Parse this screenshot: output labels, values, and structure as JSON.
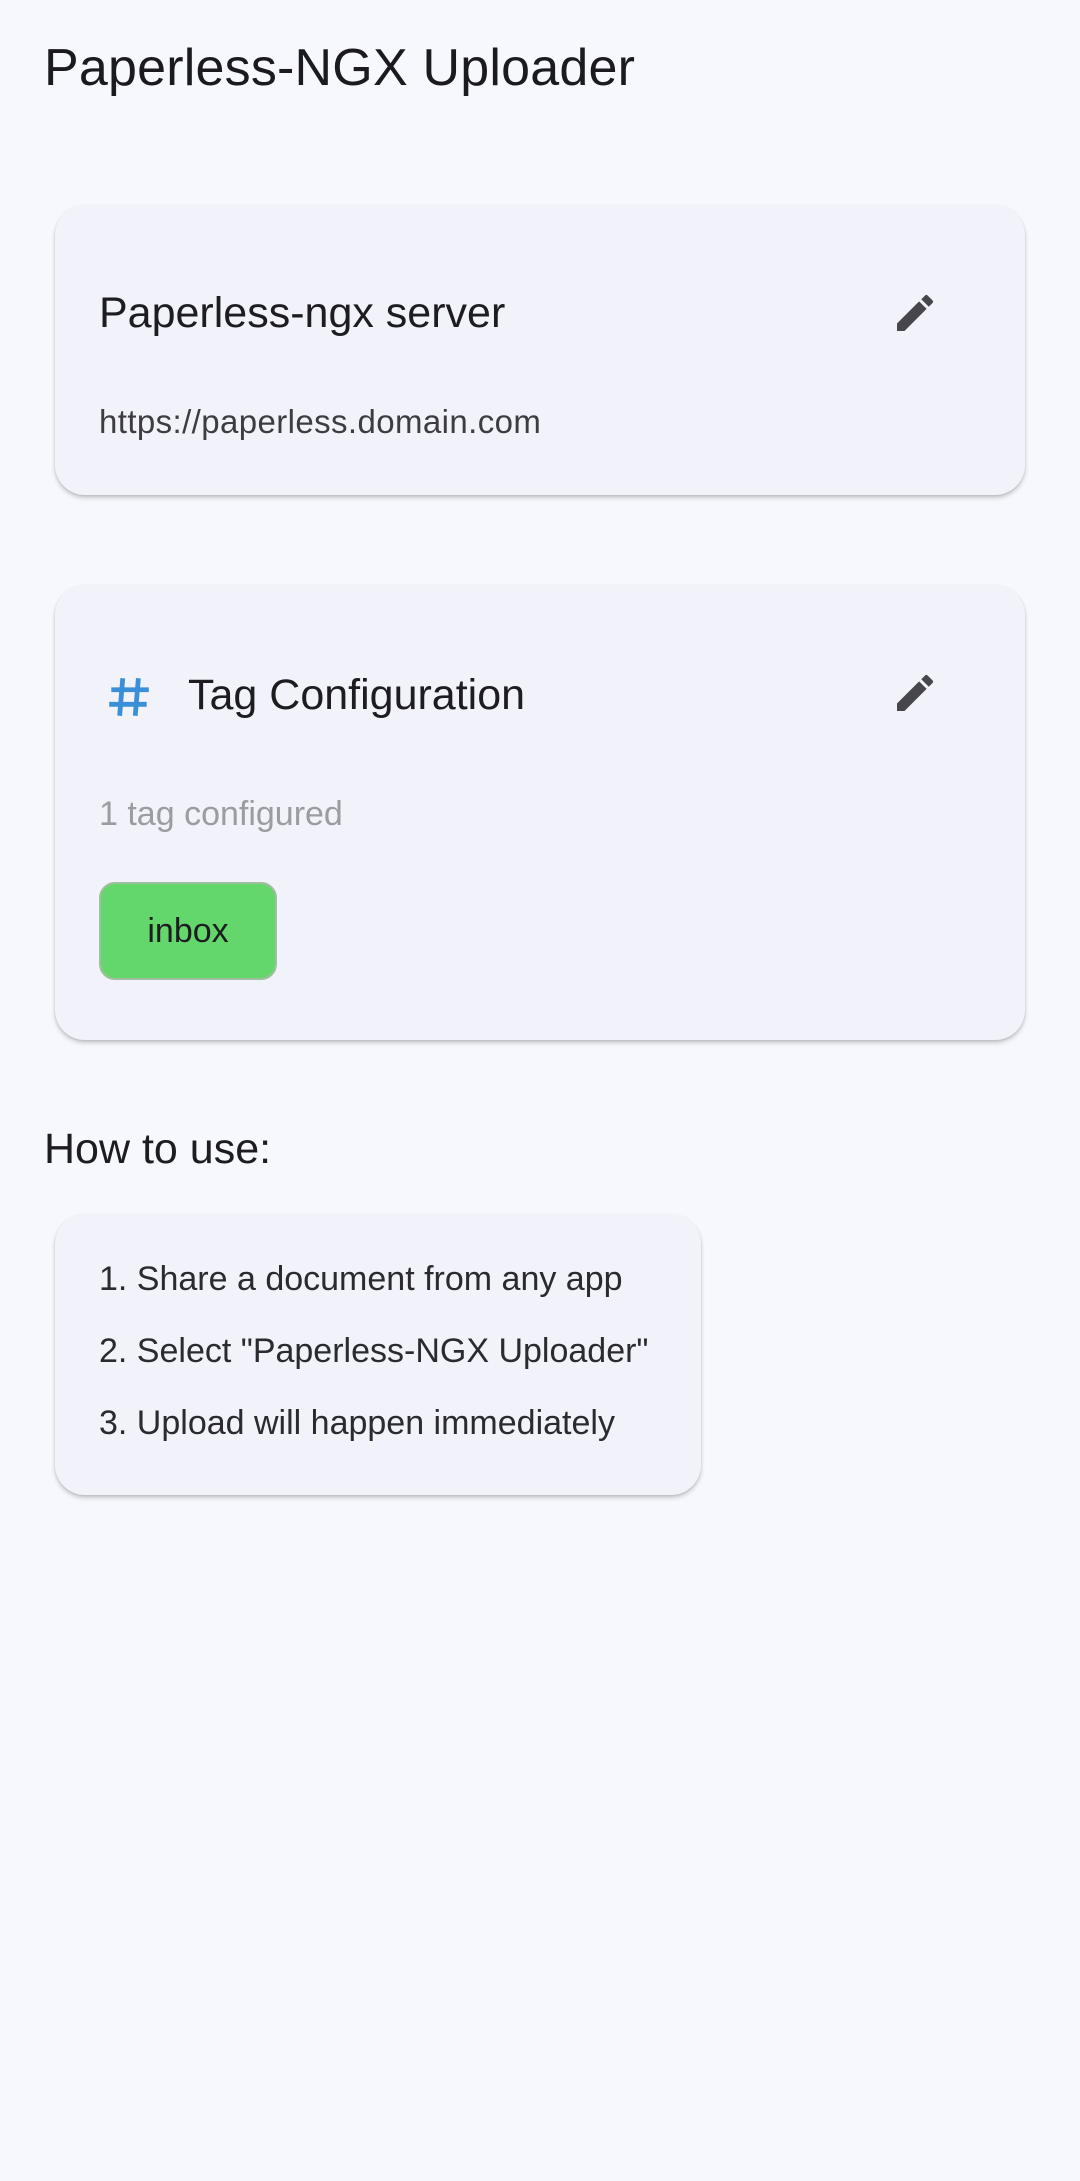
{
  "app": {
    "title": "Paperless-NGX Uploader"
  },
  "server_card": {
    "title": "Paperless-ngx server",
    "url": "https://paperless.domain.com",
    "edit_icon": "pencil-icon"
  },
  "tag_card": {
    "icon": "hash-icon",
    "title": "Tag Configuration",
    "count_text": "1 tag configured",
    "edit_icon": "pencil-icon",
    "tags": [
      {
        "label": "inbox",
        "color": "#64d76c"
      }
    ]
  },
  "how_to": {
    "title": "How to use:",
    "steps": [
      "1. Share a document from any app",
      "2. Select \"Paperless-NGX Uploader\"",
      "3. Upload will happen immediately"
    ]
  },
  "colors": {
    "background": "#f7f8fd",
    "card": "#f2f2fa",
    "accent_blue": "#3a8fd8",
    "icon_gray": "#46464c",
    "tag_green": "#64d76c"
  }
}
